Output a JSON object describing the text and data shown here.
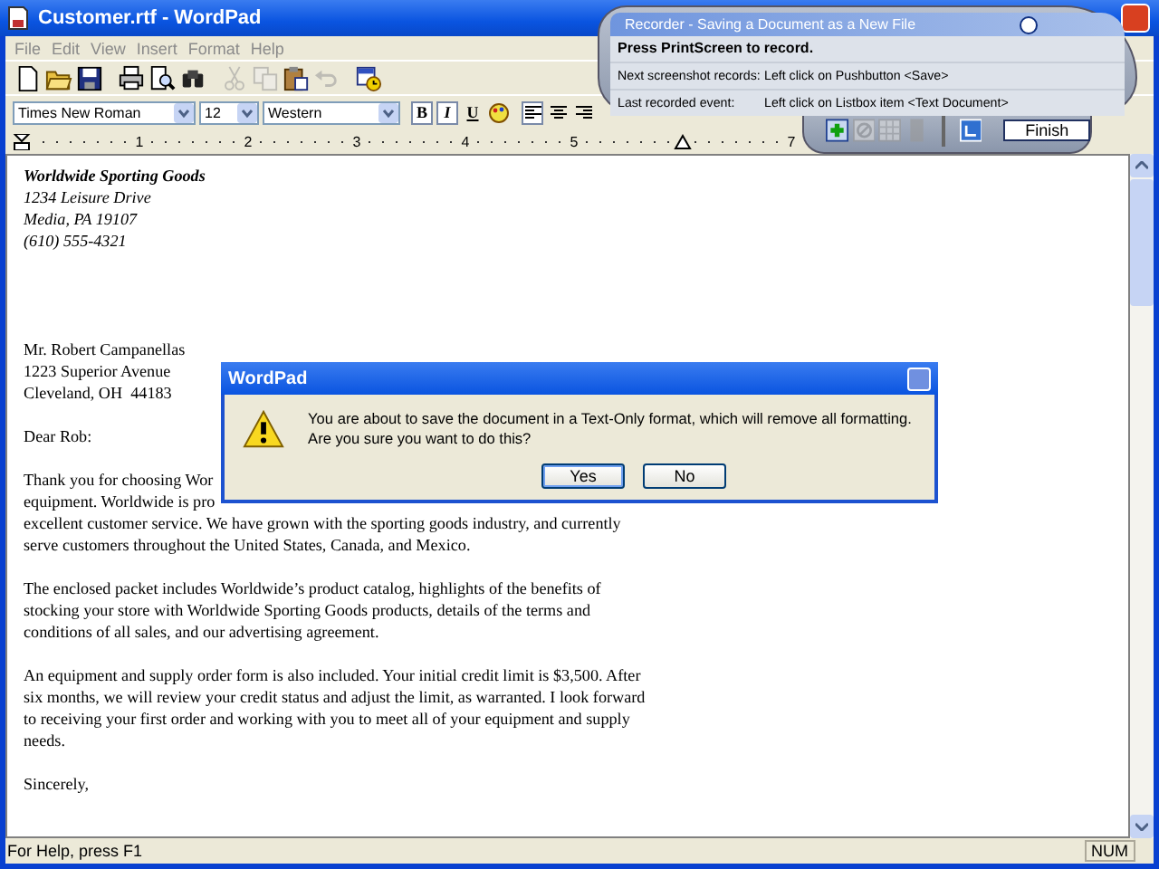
{
  "window": {
    "title": "Customer.rtf - WordPad"
  },
  "menu": [
    "File",
    "Edit",
    "View",
    "Insert",
    "Format",
    "Help"
  ],
  "toolbar": [
    {
      "kind": "new",
      "disabled": false
    },
    {
      "kind": "open",
      "disabled": false
    },
    {
      "kind": "save",
      "disabled": false
    },
    {
      "kind": "print",
      "disabled": false
    },
    {
      "kind": "preview",
      "disabled": false
    },
    {
      "kind": "find",
      "disabled": false
    },
    {
      "kind": "cut",
      "disabled": true
    },
    {
      "kind": "copy",
      "disabled": true
    },
    {
      "kind": "paste",
      "disabled": false
    },
    {
      "kind": "undo",
      "disabled": true
    },
    {
      "kind": "datetime",
      "disabled": false
    }
  ],
  "format_bar": {
    "font": "Times New Roman",
    "size": "12",
    "script": "Western",
    "styles": [
      {
        "label": "B",
        "pressed": true
      },
      {
        "label": "I",
        "pressed": true
      },
      {
        "label": "U",
        "pressed": false
      }
    ],
    "alignment": [
      {
        "kind": "left",
        "selected": true
      },
      {
        "kind": "center",
        "selected": false
      },
      {
        "kind": "right",
        "selected": false
      }
    ]
  },
  "ruler": {
    "numbers": [
      "1",
      "2",
      "3",
      "4",
      "5"
    ],
    "after_indent": [
      "7"
    ]
  },
  "document": {
    "letterhead": {
      "name": "Worldwide Sporting Goods",
      "lines": [
        "1234 Leisure Drive",
        "Media, PA 19107",
        "(610) 555-4321"
      ]
    },
    "recipient": [
      "Mr. Robert Campanellas",
      "1223 Superior Avenue",
      "Cleveland, OH  44183"
    ],
    "salutation": "Dear Rob:",
    "paragraphs": [
      [
        "Thank you for choosing Wor",
        "equipment. Worldwide is pro",
        "excellent customer service. We have grown with the sporting goods industry, and currently",
        "serve customers throughout the United States, Canada, and Mexico."
      ],
      [
        "The enclosed packet includes Worldwide’s product catalog, highlights of the benefits of",
        "stocking your store with Worldwide Sporting Goods products, details of the terms and",
        "conditions of all sales, and our advertising agreement."
      ],
      [
        "An equipment and supply order form is also included. Your initial credit limit is $3,500. After",
        "six months, we will review your credit status and adjust the limit, as warranted. I look forward",
        "to receiving your first order and working with you to meet all of your equipment and supply",
        "needs."
      ]
    ],
    "closing": "Sincerely,"
  },
  "status_bar": {
    "help": "For Help, press F1",
    "num": "NUM"
  },
  "dialog": {
    "title": "WordPad",
    "message": "You are about to save the document in a Text-Only format, which will remove all formatting. Are you sure you want to do this?",
    "buttons": [
      {
        "label": "Yes",
        "selected": true
      },
      {
        "label": "No",
        "selected": false
      }
    ]
  },
  "recorder": {
    "title": "Recorder - Saving a Document as a New File",
    "instruction": "Press PrintScreen to record.",
    "rows": [
      {
        "label": "Next screenshot records:",
        "value": "Left click on Pushbutton <Save>"
      },
      {
        "label": "Last recorded event:",
        "value": "Left click on Listbox item <Text Document>"
      }
    ],
    "tools": [
      {
        "kind": "add",
        "disabled": false
      },
      {
        "kind": "remove",
        "disabled": true
      },
      {
        "kind": "grid",
        "disabled": true
      },
      {
        "kind": "stop",
        "disabled": true
      }
    ],
    "finish": "Finish"
  }
}
